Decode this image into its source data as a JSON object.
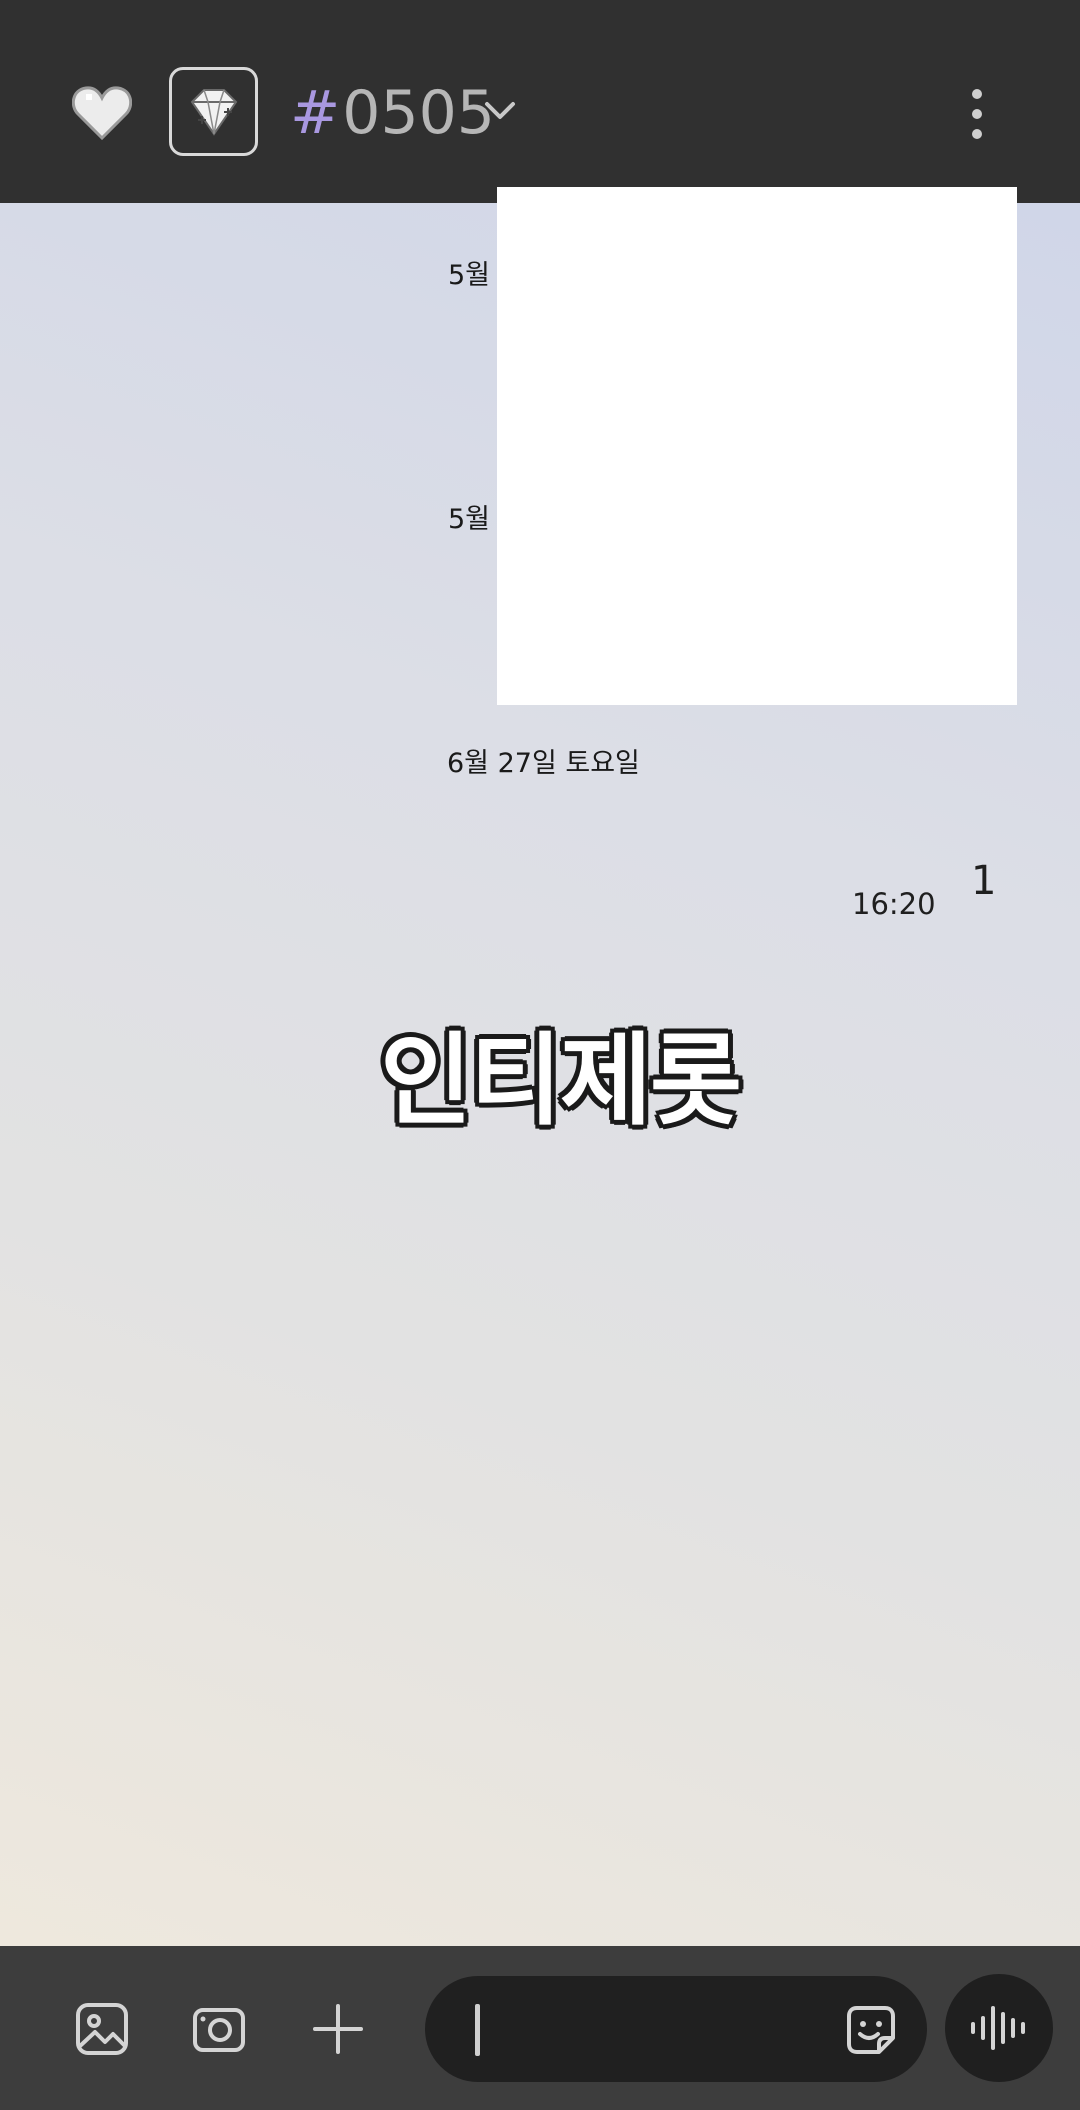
{
  "header": {
    "hash_symbol": "#",
    "chat_name": "0505",
    "icons": [
      "heart-icon",
      "diamond-icon",
      "chevron-down-icon",
      "more-vertical-icon"
    ]
  },
  "chat": {
    "dates": [
      "5월",
      "5월",
      "6월 27일 토요일"
    ],
    "message": {
      "time": "16:20",
      "unread": "1",
      "sticker_text": "인티제롯"
    }
  },
  "composer": {
    "icons": [
      "gallery-icon",
      "camera-icon",
      "plus-icon",
      "emoji-icon",
      "voice-wave-icon"
    ]
  },
  "colors": {
    "header_bg": "#303030",
    "accent_hash": "#a998e0",
    "composer_bg": "#3d3d3d",
    "input_bg": "#202020"
  }
}
